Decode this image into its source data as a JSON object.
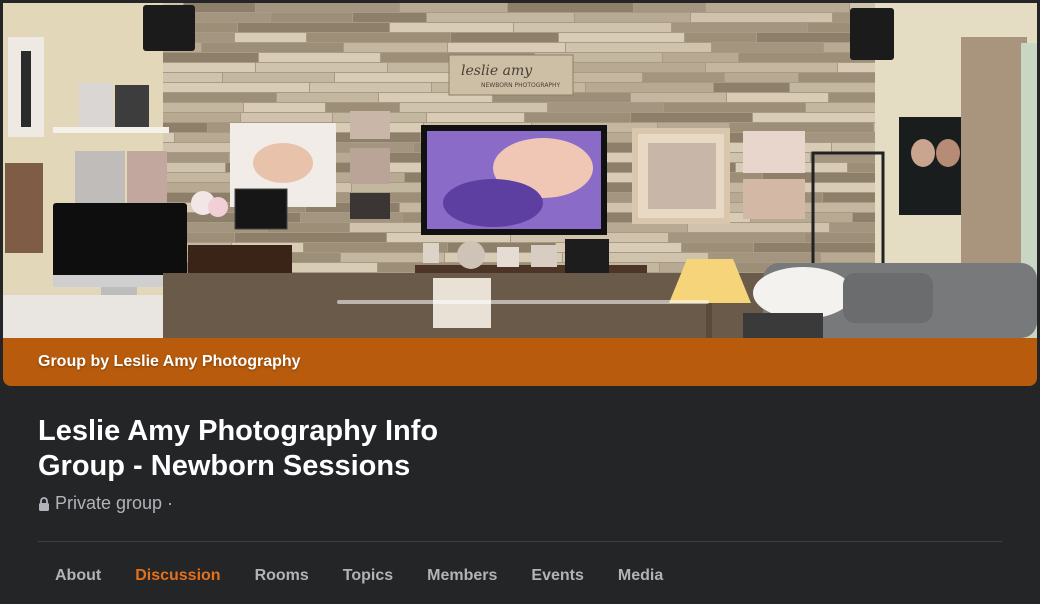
{
  "cover": {
    "band_label": "Group by Leslie Amy Photography",
    "sign_line1": "leslie amy",
    "sign_line2": "NEWBORN PHOTOGRAPHY",
    "band_color": "#b95b0c"
  },
  "group": {
    "title": "Leslie Amy Photography Info Group - Newborn Sessions",
    "privacy": "Private group",
    "separator": "·"
  },
  "tabs": [
    {
      "label": "About",
      "active": false
    },
    {
      "label": "Discussion",
      "active": true
    },
    {
      "label": "Rooms",
      "active": false
    },
    {
      "label": "Topics",
      "active": false
    },
    {
      "label": "Members",
      "active": false
    },
    {
      "label": "Events",
      "active": false
    },
    {
      "label": "Media",
      "active": false
    }
  ],
  "colors": {
    "background": "#242526",
    "accent": "#e3701b",
    "tab_text": "#b0b3b8",
    "title_text": "#ffffff"
  }
}
